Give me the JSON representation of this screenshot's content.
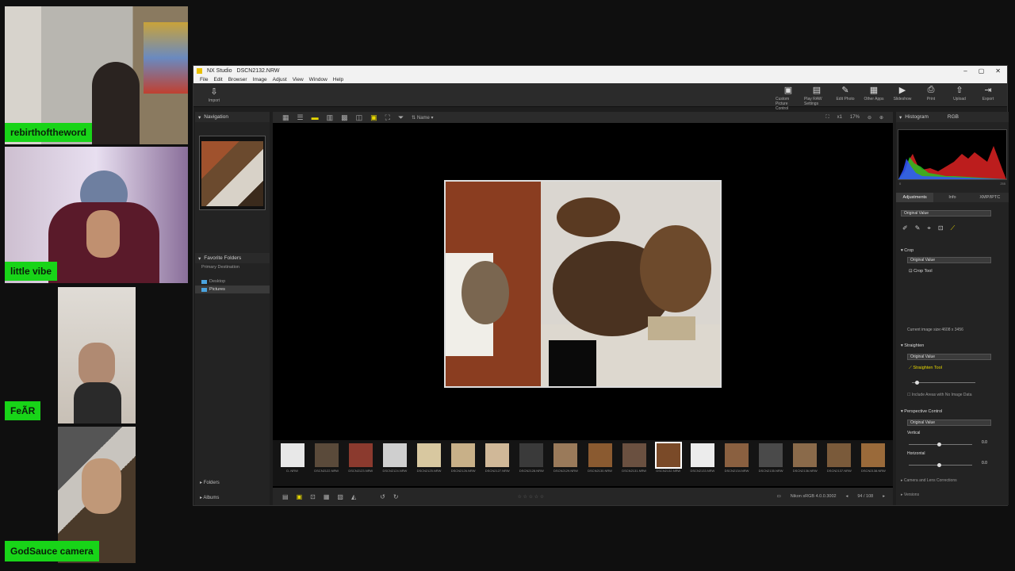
{
  "cams": [
    {
      "label": "rebirthoftheword"
    },
    {
      "label": "little vibe"
    },
    {
      "label": "FeÃR"
    },
    {
      "label": "GodSauce camera"
    }
  ],
  "app": {
    "title": "NX Studio",
    "file": "DSCN2132.NRW",
    "menu": [
      "File",
      "Edit",
      "Browser",
      "Image",
      "Adjust",
      "View",
      "Window",
      "Help"
    ],
    "import_label": "Import",
    "tools": [
      "Custom Picture Control",
      "Play RAW Settings",
      "Edit Photo",
      "Other Apps",
      "Slideshow",
      "Print",
      "Upload",
      "Export"
    ]
  },
  "left": {
    "navigation_title": "Navigation",
    "favorites_title": "Favorite Folders",
    "primary_destination": "Primary Destination",
    "folders": [
      "Desktop",
      "Pictures"
    ],
    "selected_folder": "Pictures",
    "folders_title": "Folders",
    "albums_title": "Albums"
  },
  "center": {
    "sort_label": "Name",
    "zoom_preset": "x1",
    "zoom": "17%",
    "color_space": "Nikon sRGB 4.0.0.3002",
    "counter": "94 / 108",
    "thumbs": [
      {
        "name": "D..NRW",
        "color": "#e8e8e8"
      },
      {
        "name": "DSCN2122.NRW",
        "color": "#5a4a3a"
      },
      {
        "name": "DSCN2123.NRW",
        "color": "#8b3a2e"
      },
      {
        "name": "DSCN2124.NRW",
        "color": "#cfcfcf"
      },
      {
        "name": "DSCN2125.NRW",
        "color": "#d8c8a0"
      },
      {
        "name": "DSCN2126.NRW",
        "color": "#c8b088"
      },
      {
        "name": "DSCN2127.NRW",
        "color": "#d0b898"
      },
      {
        "name": "DSCN2128.NRW",
        "color": "#3a3a3a"
      },
      {
        "name": "DSCN2129.NRW",
        "color": "#9a7a5a"
      },
      {
        "name": "DSCN2130.NRW",
        "color": "#8a5a30"
      },
      {
        "name": "DSCN2131.NRW",
        "color": "#6a5040"
      },
      {
        "name": "DSCN2132.NRW",
        "color": "#7a4a28"
      },
      {
        "name": "DSCN2133.NRW",
        "color": "#ececec"
      },
      {
        "name": "DSCN2134.NRW",
        "color": "#8a6040"
      },
      {
        "name": "DSCN2135.NRW",
        "color": "#4a4a4a"
      },
      {
        "name": "DSCN2136.NRW",
        "color": "#8a6a4a"
      },
      {
        "name": "DSCN2137.NRW",
        "color": "#7a5a3a"
      },
      {
        "name": "DSCN2138.NRW",
        "color": "#9a6a3a"
      }
    ],
    "selected_index": 11
  },
  "right": {
    "histogram_title": "Histogram",
    "histogram_channel": "RGB",
    "hist_min": "0",
    "hist_max": "255",
    "tabs": [
      "Adjustments",
      "Info",
      "XMP/IPTC"
    ],
    "preset": "Original Value",
    "crop_title": "Crop",
    "crop_value": "Original Value",
    "crop_tool": "Crop Tool",
    "current_size": "Current image size:4608 x 3456",
    "straighten_title": "Straighten",
    "straighten_value": "Original Value",
    "straighten_tool": "Straighten Tool",
    "include_areas": "Include Areas with No Image Data",
    "perspective_title": "Perspective Control",
    "perspective_value": "Original Value",
    "vertical_label": "Vertical",
    "vertical_value": "0.0",
    "horizontal_label": "Horizontal",
    "horizontal_value": "0.0",
    "camera_lens": "Camera and Lens Corrections",
    "versions": "Versions"
  }
}
